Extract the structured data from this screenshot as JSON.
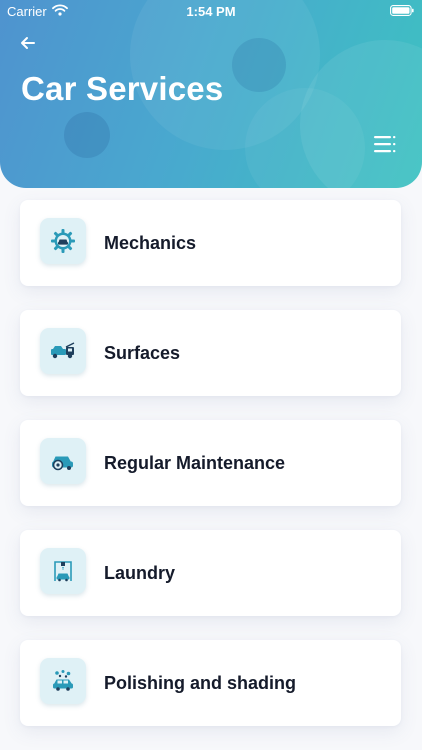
{
  "status_bar": {
    "carrier": "Carrier",
    "time": "1:54 PM"
  },
  "header": {
    "title": "Car Services",
    "back_icon": "arrow-left-icon",
    "menu_icon": "menu-icon",
    "gradient_colors": [
      "#4f93cf",
      "#3dc2c1"
    ]
  },
  "services": [
    {
      "label": "Mechanics",
      "icon": "gear-car-icon"
    },
    {
      "label": "Surfaces",
      "icon": "tow-truck-icon"
    },
    {
      "label": "Regular Maintenance",
      "icon": "car-repair-icon"
    },
    {
      "label": "Laundry",
      "icon": "car-wash-icon"
    },
    {
      "label": "Polishing and shading",
      "icon": "car-polish-icon"
    }
  ],
  "colors": {
    "accent": "#2a9ab8",
    "icon_bg": "#dff1f6",
    "text": "#151b2b"
  }
}
